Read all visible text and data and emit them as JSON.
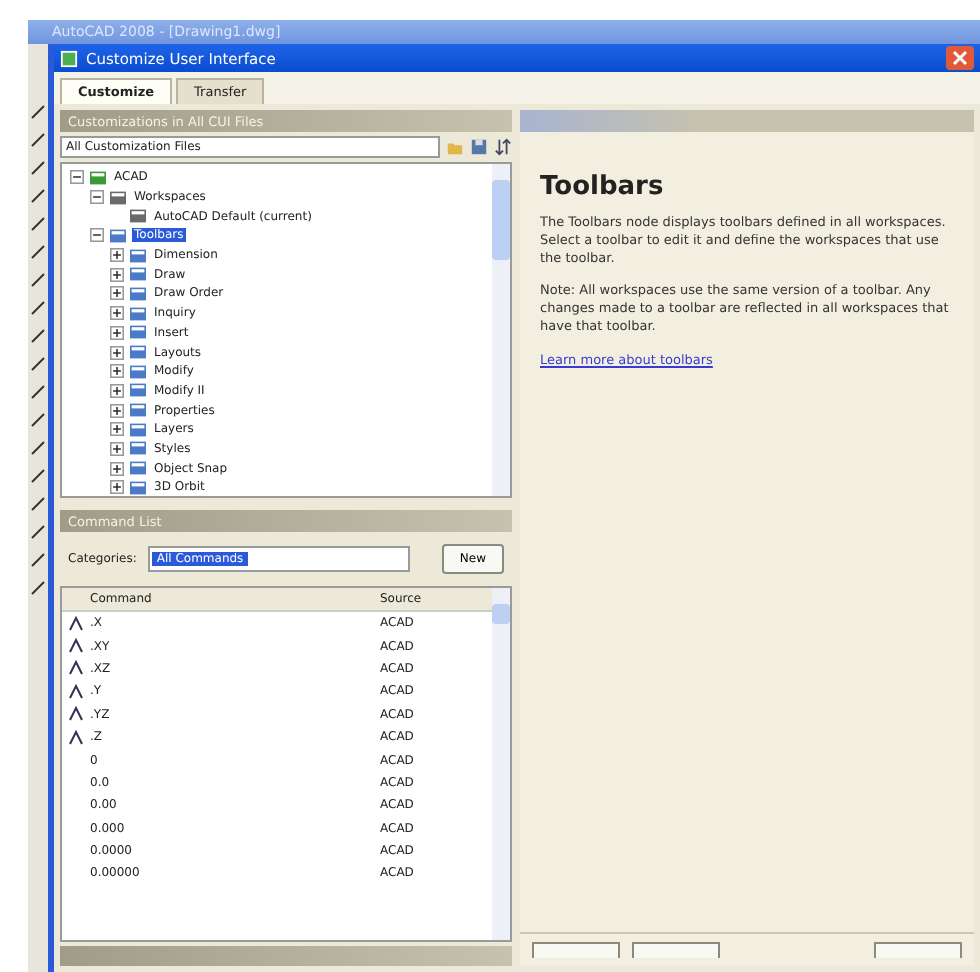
{
  "app_title": "AutoCAD 2008 - [Drawing1.dwg]",
  "dialog": {
    "title": "Customize User Interface"
  },
  "tabs": [
    {
      "label": "Customize",
      "selected": true
    },
    {
      "label": "Transfer",
      "selected": false
    }
  ],
  "customizations_panel": {
    "header": "Customizations in All CUI Files",
    "file_filter": "All Customization Files",
    "tree": [
      {
        "label": "ACAD",
        "kind": "file",
        "expanded": true,
        "selected": false,
        "children": [
          {
            "label": "Workspaces",
            "kind": "workspaces",
            "expanded": true,
            "selected": false,
            "children": [
              {
                "label": "AutoCAD Default (current)",
                "kind": "workspace",
                "selected": false
              }
            ]
          },
          {
            "label": "Toolbars",
            "kind": "toolbars",
            "expanded": true,
            "selected": true,
            "children": [
              {
                "label": "Dimension",
                "kind": "toolbar",
                "expanded": false,
                "selected": false
              },
              {
                "label": "Draw",
                "kind": "toolbar",
                "expanded": false,
                "selected": false
              },
              {
                "label": "Draw Order",
                "kind": "toolbar",
                "expanded": false,
                "selected": false
              },
              {
                "label": "Inquiry",
                "kind": "toolbar",
                "expanded": false,
                "selected": false
              },
              {
                "label": "Insert",
                "kind": "toolbar",
                "expanded": false,
                "selected": false
              },
              {
                "label": "Layouts",
                "kind": "toolbar",
                "expanded": false,
                "selected": false
              },
              {
                "label": "Modify",
                "kind": "toolbar",
                "expanded": false,
                "selected": false
              },
              {
                "label": "Modify II",
                "kind": "toolbar",
                "expanded": false,
                "selected": false
              },
              {
                "label": "Properties",
                "kind": "toolbar",
                "expanded": false,
                "selected": false
              },
              {
                "label": "Layers",
                "kind": "toolbar",
                "expanded": false,
                "selected": false
              },
              {
                "label": "Styles",
                "kind": "toolbar",
                "expanded": false,
                "selected": false
              },
              {
                "label": "Object Snap",
                "kind": "toolbar",
                "expanded": false,
                "selected": false
              },
              {
                "label": "3D Orbit",
                "kind": "toolbar",
                "expanded": false,
                "selected": false
              }
            ]
          }
        ]
      }
    ]
  },
  "command_list": {
    "header": "Command List",
    "categories_label": "Categories:",
    "category": "All Commands",
    "new_button": "New",
    "columns": [
      "Command",
      "Source"
    ],
    "rows": [
      {
        "command": ".X",
        "source": "ACAD",
        "icon": true
      },
      {
        "command": ".XY",
        "source": "ACAD",
        "icon": true
      },
      {
        "command": ".XZ",
        "source": "ACAD",
        "icon": true
      },
      {
        "command": ".Y",
        "source": "ACAD",
        "icon": true
      },
      {
        "command": ".YZ",
        "source": "ACAD",
        "icon": true
      },
      {
        "command": ".Z",
        "source": "ACAD",
        "icon": true
      },
      {
        "command": "0",
        "source": "ACAD",
        "icon": false
      },
      {
        "command": "0.0",
        "source": "ACAD",
        "icon": false
      },
      {
        "command": "0.00",
        "source": "ACAD",
        "icon": false
      },
      {
        "command": "0.000",
        "source": "ACAD",
        "icon": false
      },
      {
        "command": "0.0000",
        "source": "ACAD",
        "icon": false
      },
      {
        "command": "0.00000",
        "source": "ACAD",
        "icon": false
      }
    ]
  },
  "information": {
    "heading": "Toolbars",
    "paragraphs": [
      "The Toolbars node displays toolbars defined in all workspaces. Select a toolbar to edit it and define the workspaces that use the toolbar.",
      "Note: All workspaces use the same version of a toolbar. Any changes made to a toolbar are reflected in all workspaces that have that toolbar."
    ],
    "link": "Learn more about toolbars"
  }
}
